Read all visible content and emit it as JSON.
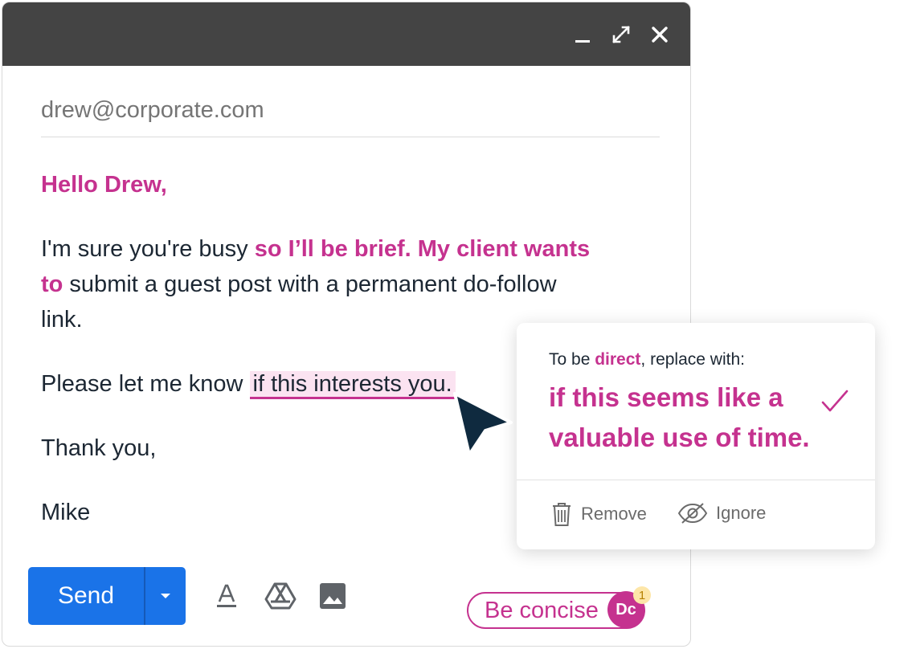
{
  "window": {
    "minimize_icon": "minimize-icon",
    "expand_icon": "expand-icon",
    "close_icon": "close-icon"
  },
  "email": {
    "to": "drew@corporate.com",
    "greeting": "Hello Drew,",
    "para1_a": "I'm sure you're busy ",
    "para1_hl": "so I’ll be brief. My client wants to",
    "para1_b": " submit a guest post with a permanent do-follow link.",
    "para2_a": "Please let me know ",
    "para2_flagged": "if this interests you.",
    "closing": "Thank you,",
    "signature": "Mike"
  },
  "toolbar": {
    "send_label": "Send",
    "more_icon": "caret-down-icon",
    "format_icon": "text-format-icon",
    "drive_icon": "drive-icon",
    "photo_icon": "image-icon"
  },
  "assistant": {
    "pill_label": "Be concise",
    "avatar_initials": "Dc",
    "badge_count": "1"
  },
  "suggestion": {
    "hint_prefix": "To be ",
    "hint_keyword": "direct",
    "hint_suffix": ", replace with:",
    "replacement": "if this seems like a valuable use of time.",
    "remove_label": "Remove",
    "ignore_label": "Ignore"
  },
  "colors": {
    "accent": "#c5328f",
    "send_blue": "#1a73e8",
    "titlebar": "#444444",
    "highlight_bg": "#fbe3f1"
  }
}
